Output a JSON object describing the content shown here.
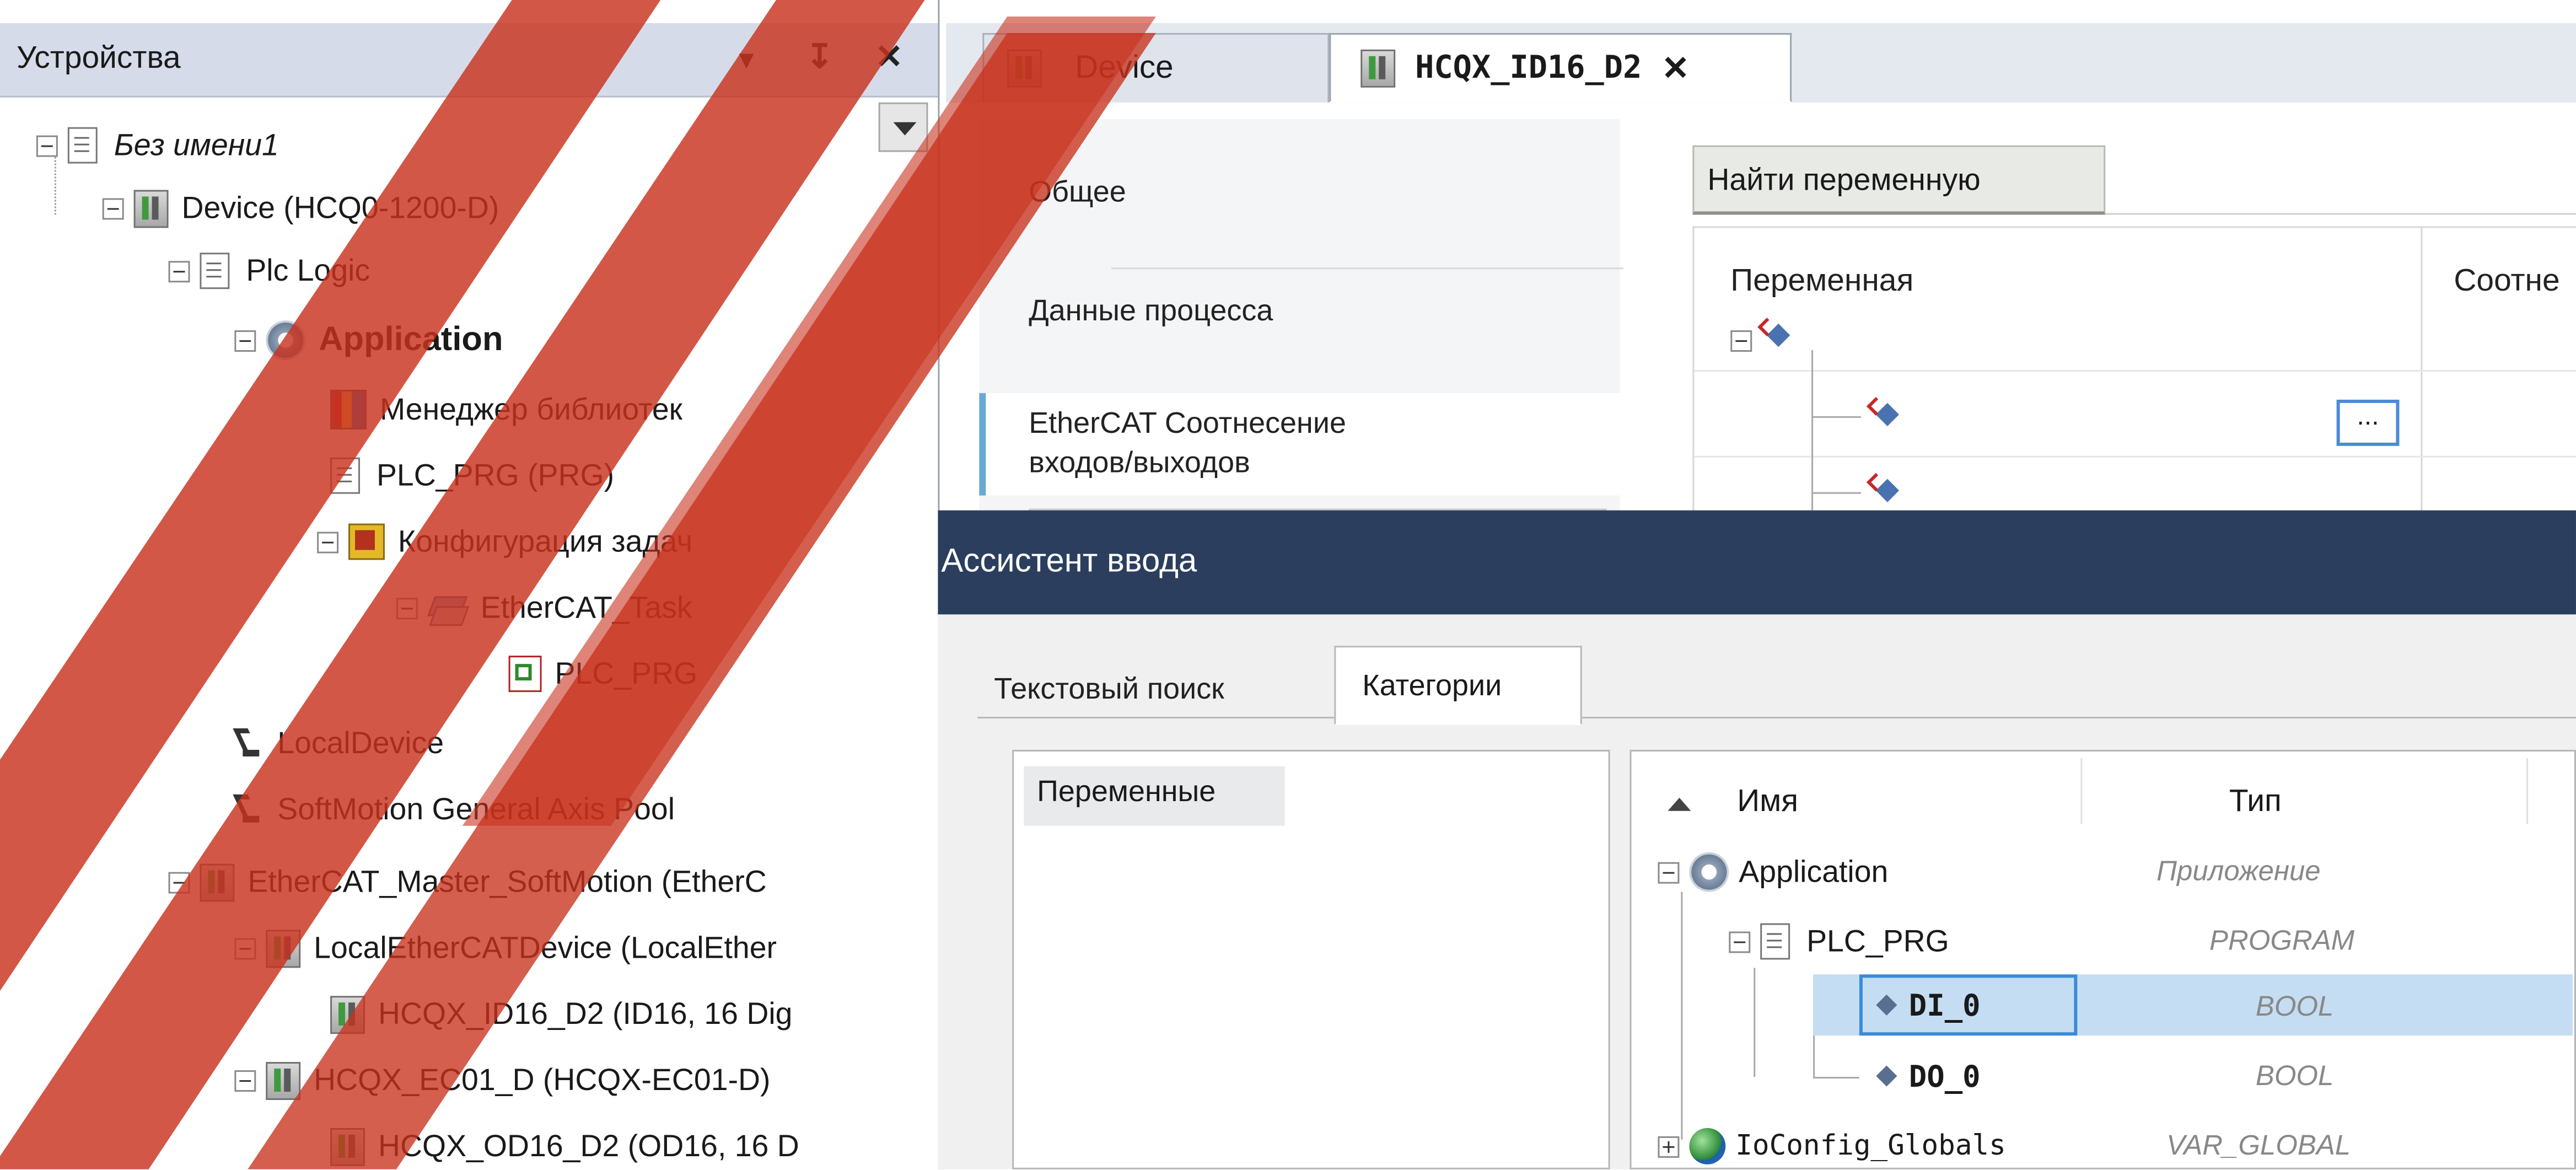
{
  "left_panel": {
    "title": "Устройства",
    "pin_glyph": "↧",
    "dropdown_glyph": "▾",
    "close_glyph": "✕",
    "tree": [
      {
        "label": "Без имени1",
        "icon": "project-page-icon"
      },
      {
        "label": "Device (HCQ0-1200-D)",
        "icon": "device-icon"
      },
      {
        "label": "Plc Logic",
        "icon": "plc-logic-icon"
      },
      {
        "label": "Application",
        "icon": "application-gear-icon"
      },
      {
        "label": "Менеджер библиотек",
        "icon": "library-manager-icon"
      },
      {
        "label": "PLC_PRG (PRG)",
        "icon": "program-page-icon"
      },
      {
        "label": "Конфигурация задач",
        "icon": "task-config-icon"
      },
      {
        "label": "EtherCAT_Task",
        "icon": "task-layers-icon"
      },
      {
        "label": "PLC_PRG",
        "icon": "program-call-icon"
      },
      {
        "label": "LocalDevice",
        "icon": "axis-icon"
      },
      {
        "label": "SoftMotion General Axis Pool",
        "icon": "axis-icon"
      },
      {
        "label": "EtherCAT_Master_SoftMotion (EtherC",
        "icon": "device-icon"
      },
      {
        "label": "LocalEtherCATDevice (LocalEther",
        "icon": "device-icon"
      },
      {
        "label": "HCQX_ID16_D2 (ID16, 16 Dig",
        "icon": "device-icon"
      },
      {
        "label": "HCQX_EC01_D (HCQX-EC01-D)",
        "icon": "device-icon"
      },
      {
        "label": "HCQX_OD16_D2 (OD16, 16 D",
        "icon": "device-icon"
      }
    ]
  },
  "tabs": [
    {
      "label": "Device",
      "active": false
    },
    {
      "label": "HCQX_ID16_D2",
      "active": true,
      "close_glyph": "✕"
    }
  ],
  "editor": {
    "nav": [
      {
        "label": "Общее"
      },
      {
        "label": "Данные процесса"
      },
      {
        "label": "EtherCAT Соотнесение входов/выходов",
        "line1": "EtherCAT Соотнесение",
        "line2": "входов/выходов",
        "selected": true
      }
    ],
    "find_button": "Найти переменную",
    "columns": [
      "Переменная",
      "Соотне"
    ],
    "ellipsis": "..."
  },
  "dialog": {
    "title": "Ассистент ввода",
    "tabs": [
      {
        "label": "Текстовый поиск",
        "active": false
      },
      {
        "label": "Категории",
        "active": true
      }
    ],
    "categories": [
      "Переменные"
    ],
    "list_headers": {
      "name": "Имя",
      "type": "Тип"
    },
    "rows": [
      {
        "name": "Application",
        "type": "Приложение",
        "icon": "application-gear-icon"
      },
      {
        "name": "PLC_PRG",
        "type": "PROGRAM",
        "icon": "program-page-icon"
      },
      {
        "name": "DI_0",
        "type": "BOOL",
        "icon": "variable-icon",
        "selected": true
      },
      {
        "name": "DO_0",
        "type": "BOOL",
        "icon": "variable-icon"
      },
      {
        "name": "IoConfig_Globals",
        "type": "VAR_GLOBAL",
        "icon": "globe-icon"
      }
    ]
  },
  "colors": {
    "dialog_title_bg": "#2b3e5e",
    "selection_bg": "#c4ddf2",
    "selection_border": "#3b8ad6",
    "watermark": "#c8321e"
  }
}
